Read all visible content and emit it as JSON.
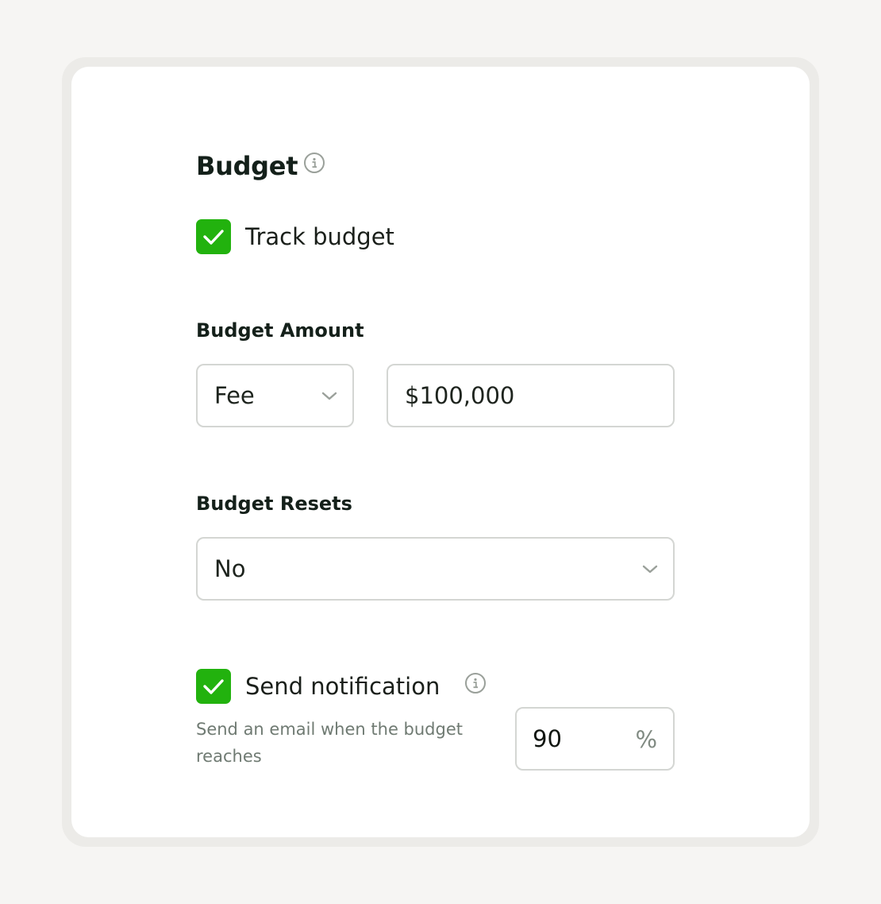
{
  "budget": {
    "title": "Budget",
    "track_budget": {
      "label": "Track budget",
      "checked": true
    },
    "amount": {
      "label": "Budget Amount",
      "type_select": {
        "value": "Fee"
      },
      "amount_input": {
        "value": "$100,000"
      }
    },
    "resets": {
      "label": "Budget Resets",
      "select": {
        "value": "No"
      }
    },
    "notification": {
      "label": "Send notification",
      "checked": true,
      "help_line1": "Send an email when the budget",
      "help_line2": "reaches",
      "threshold": {
        "value": "90",
        "unit": "%"
      }
    }
  },
  "colors": {
    "accent_green": "#22b20e",
    "border": "#d4d6d3",
    "background": "#f6f5f3"
  },
  "icons": [
    "info-icon",
    "check-icon",
    "chevron-down-icon"
  ]
}
